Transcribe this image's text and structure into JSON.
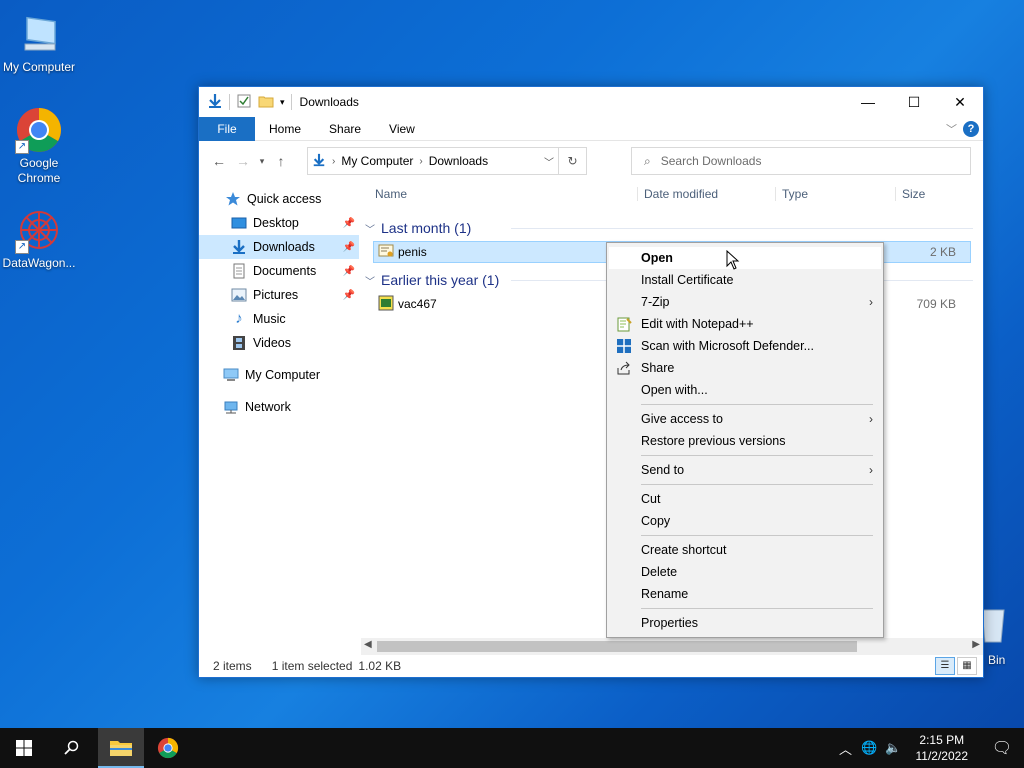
{
  "desktop": {
    "icons": [
      {
        "label": "My Computer"
      },
      {
        "label": "Google Chrome"
      },
      {
        "label": "DataWagon..."
      }
    ],
    "recycle_label": "Bin"
  },
  "window": {
    "title": "Downloads",
    "controls": {
      "minimize": "—",
      "maximize": "☐",
      "close": "✕"
    },
    "ribbon_tabs": [
      "File",
      "Home",
      "Share",
      "View"
    ],
    "help_label": "?",
    "address": {
      "crumbs": [
        "My Computer",
        "Downloads"
      ]
    },
    "search_placeholder": "Search Downloads",
    "nav_pane": {
      "items": [
        {
          "label": "Quick access",
          "icon": "star-icon"
        },
        {
          "label": "Desktop",
          "icon": "desktop-folder-icon",
          "pinned": true
        },
        {
          "label": "Downloads",
          "icon": "download-arrow-icon",
          "pinned": true,
          "selected": true
        },
        {
          "label": "Documents",
          "icon": "documents-icon",
          "pinned": true
        },
        {
          "label": "Pictures",
          "icon": "pictures-icon",
          "pinned": true
        },
        {
          "label": "Music",
          "icon": "music-note-icon"
        },
        {
          "label": "Videos",
          "icon": "film-icon"
        },
        {
          "label": "My Computer",
          "icon": "computer-icon"
        },
        {
          "label": "Network",
          "icon": "network-icon"
        }
      ]
    },
    "columns": [
      "Name",
      "Date modified",
      "Type",
      "Size"
    ],
    "groups": [
      {
        "label": "Last month (1)",
        "files": [
          {
            "name": "penis",
            "size": "2 KB",
            "icon": "certificate-icon",
            "selected": true
          }
        ]
      },
      {
        "label": "Earlier this year (1)",
        "files": [
          {
            "name": "vac467",
            "size": "709 KB",
            "icon": "app-icon",
            "selected": false
          }
        ]
      }
    ],
    "status": {
      "count": "2 items",
      "selection": "1 item selected",
      "size": "1.02 KB"
    }
  },
  "context_menu": {
    "sections": [
      [
        {
          "label": "Open",
          "bold": true
        },
        {
          "label": "Install Certificate"
        },
        {
          "label": "7-Zip",
          "submenu": true
        },
        {
          "label": "Edit with Notepad++",
          "icon": "notepad-icon"
        },
        {
          "label": "Scan with Microsoft Defender...",
          "icon": "defender-icon"
        },
        {
          "label": "Share",
          "icon": "share-icon"
        },
        {
          "label": "Open with..."
        }
      ],
      [
        {
          "label": "Give access to",
          "submenu": true
        },
        {
          "label": "Restore previous versions"
        }
      ],
      [
        {
          "label": "Send to",
          "submenu": true
        }
      ],
      [
        {
          "label": "Cut"
        },
        {
          "label": "Copy"
        }
      ],
      [
        {
          "label": "Create shortcut"
        },
        {
          "label": "Delete"
        },
        {
          "label": "Rename"
        }
      ],
      [
        {
          "label": "Properties"
        }
      ]
    ]
  },
  "taskbar": {
    "clock_time": "2:15 PM",
    "clock_date": "11/2/2022"
  },
  "colors": {
    "accent": "#1a6fc4",
    "selection": "#cce8ff",
    "taskbar": "#101010"
  }
}
